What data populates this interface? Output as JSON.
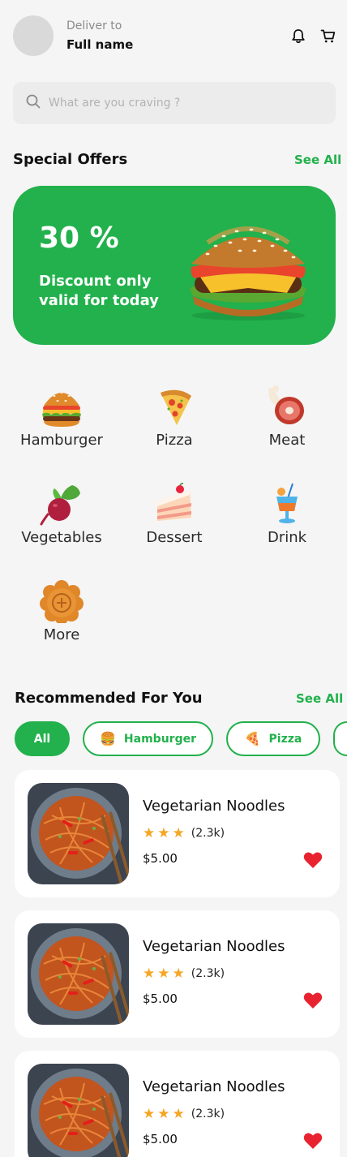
{
  "header": {
    "deliver_label": "Deliver to",
    "deliver_name": "Full name",
    "icons": [
      "bell-icon",
      "cart-icon"
    ]
  },
  "search": {
    "placeholder": "What are you craving ?",
    "value": ""
  },
  "special_offers": {
    "title": "Special Offers",
    "see_all": "See All",
    "banner": {
      "discount": "30 %",
      "text": "Discount only valid for today",
      "image": "burger"
    }
  },
  "categories": [
    {
      "label": "Hamburger",
      "icon": "🍔"
    },
    {
      "label": "Pizza",
      "icon": "🍕"
    },
    {
      "label": "Meat",
      "icon": "🍖"
    },
    {
      "label": "Vegetables",
      "icon": "beet"
    },
    {
      "label": "Dessert",
      "icon": "🍰"
    },
    {
      "label": "Drink",
      "icon": "🍹"
    },
    {
      "label": "More",
      "icon": "mooncake"
    }
  ],
  "recommended": {
    "title": "Recommended For You",
    "see_all": "See All",
    "filters": [
      {
        "label": "All",
        "icon": "",
        "active": true
      },
      {
        "label": "Hamburger",
        "icon": "🍔",
        "active": false
      },
      {
        "label": "Pizza",
        "icon": "🍕",
        "active": false
      }
    ],
    "items": [
      {
        "name": "Vegetarian Noodles",
        "stars": 3,
        "rating_count": "(2.3k)",
        "price": "$5.00",
        "favorite": true
      },
      {
        "name": "Vegetarian Noodles",
        "stars": 3,
        "rating_count": "(2.3k)",
        "price": "$5.00",
        "favorite": true
      },
      {
        "name": "Vegetarian Noodles",
        "stars": 3,
        "rating_count": "(2.3k)",
        "price": "$5.00",
        "favorite": true
      }
    ]
  },
  "colors": {
    "accent": "#22b14c",
    "star": "#f5a623",
    "heart": "#e8232f",
    "background": "#f5f5f5"
  }
}
